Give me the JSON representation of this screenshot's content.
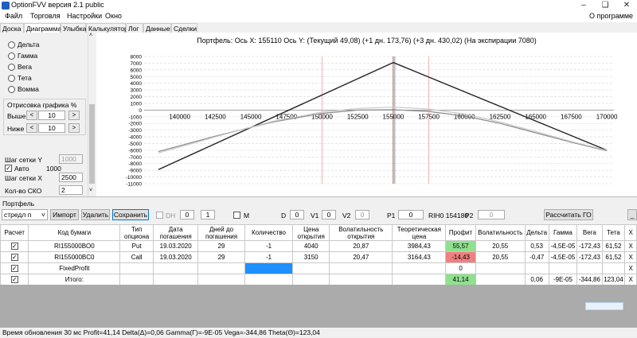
{
  "window": {
    "title": "OptionFVV версия 2.1 public"
  },
  "menu": {
    "items": [
      "Файл",
      "Торговля",
      "Настройки",
      "Окно"
    ],
    "right": "О программе"
  },
  "tabs": [
    {
      "label": "Доска",
      "active": false
    },
    {
      "label": "Диаграмма",
      "active": true
    },
    {
      "label": "Улыбка",
      "active": false
    },
    {
      "label": "Калькулятор",
      "active": false
    },
    {
      "label": "Лог",
      "active": false
    },
    {
      "label": "Данные",
      "active": false
    },
    {
      "label": "Сделки",
      "active": false
    }
  ],
  "left_panel": {
    "radios": [
      "Дельта",
      "Гамма",
      "Вега",
      "Тета",
      "Вомма"
    ],
    "plot_group": {
      "title": "Отрисовка графика %",
      "above_label": "Выше",
      "above_value": "10",
      "below_label": "Ниже",
      "below_value": "10"
    },
    "grid_y_label": "Шаг сетки Y",
    "grid_y_value": "1000",
    "auto_label": "Авто",
    "auto_checked": true,
    "auto_value": "1000",
    "grid_x_label": "Шаг сетки X",
    "grid_x_value": "2500",
    "sko_label": "Кол-во СКО",
    "sko_value": "2"
  },
  "chart_data": {
    "type": "line",
    "title": "Портфель:  Ось X: 155110 Ось Y:  (Текущий 49,08)  (+1 дн. 173,76)  (+3 дн. 430,02)  (На экспирации 7080)",
    "x_ticks": [
      140000,
      142500,
      145000,
      147500,
      150000,
      152500,
      155000,
      157500,
      160000,
      162500,
      165000,
      167500,
      170000
    ],
    "x_tick_labels": [
      "140000",
      "142500",
      "145000",
      "147500",
      "150000",
      "152500",
      "155000",
      "157500",
      "160000",
      "162500",
      "165000",
      "167500",
      "170000"
    ],
    "y_ticks": [
      8000,
      7000,
      6000,
      5000,
      4000,
      3000,
      2000,
      1000,
      0,
      -1000,
      -2000,
      -3000,
      -4000,
      -5000,
      -6000,
      -7000,
      -8000,
      -9000,
      -10000,
      -11000
    ],
    "y_tick_labels": [
      "8000",
      "7000",
      "6000",
      "5000",
      "4000",
      "3000",
      "2000",
      "1000",
      "0",
      "-1000",
      "-2000",
      "-3000",
      "-4000",
      "-5000",
      "-6000",
      "-7000",
      "-8000",
      "-9000",
      "-10000",
      "-11000"
    ],
    "xlim": [
      137500,
      170500
    ],
    "ylim": [
      -11000,
      8000
    ],
    "grid": true,
    "series": [
      {
        "role": "expiration",
        "color": "#222222",
        "x": [
          138500,
          155000,
          170000
        ],
        "y": [
          -8900,
          7100,
          -6000
        ]
      },
      {
        "role": "current",
        "color": "#8a8a8a",
        "x": [
          138500,
          142500,
          146500,
          150000,
          152500,
          155000,
          157500,
          160000,
          162500,
          165000,
          167500,
          170000
        ],
        "y": [
          -6200,
          -3900,
          -1800,
          -500,
          0,
          49,
          -200,
          -900,
          -2000,
          -3400,
          -4800,
          -6100
        ]
      },
      {
        "role": "plus_3d",
        "color": "#c8c8c8",
        "x": [
          138500,
          142500,
          146500,
          150000,
          152500,
          155000,
          157500,
          160000,
          162500,
          165000,
          167500,
          170000
        ],
        "y": [
          -6400,
          -4000,
          -1700,
          -300,
          250,
          430,
          150,
          -600,
          -1800,
          -3200,
          -4700,
          -6000
        ]
      }
    ],
    "markers": {
      "red_lines": [
        150000,
        157500
      ],
      "dark_line": 155000,
      "cursor_x": 155110
    }
  },
  "portfolio": {
    "label": "Портфель",
    "select_value": "стредл п",
    "import_label": "Импорт",
    "delete_label": "Удалить",
    "save_label": "Сохранить",
    "dh_label": "DH",
    "spin1": "0",
    "spin2": "1",
    "m_label": "M",
    "d_label": "D",
    "d_value": "0",
    "v1_label": "V1",
    "v1_value": "0",
    "v2_label": "V2",
    "v2_value": "0",
    "p1_label": "P1",
    "p1_value": "0",
    "rih_label": "RIH0 154180",
    "p2_label": "P2",
    "p2_value": "0",
    "calc_label": "Рассчитать ГО",
    "min_label": "_"
  },
  "table": {
    "headers": [
      "Расчет",
      "Код бумаги",
      "Тип опциона",
      "Дата погашения",
      "Дней до погашения",
      "Количество",
      "Цена открытия",
      "Волатильность открытия",
      "Теоретическая цена",
      "Профит",
      "Волатильность",
      "Дельта",
      "Гамма",
      "Вега",
      "Тета",
      "X"
    ],
    "rows": [
      {
        "check": true,
        "cells": [
          "RI155000BO0",
          "Put",
          "19.03.2020",
          "29",
          "-1",
          "4040",
          "20,87",
          "3984,43",
          "55,57",
          "20,55",
          "0,53",
          "-4,5E-05",
          "-172,43",
          "61,52",
          "X"
        ]
      },
      {
        "check": true,
        "cells": [
          "RI155000BC0",
          "Call",
          "19.03.2020",
          "29",
          "-1",
          "3150",
          "20,47",
          "3164,43",
          "-14,43",
          "20,55",
          "-0,47",
          "-4,5E-05",
          "-172,43",
          "61,52",
          "X"
        ]
      },
      {
        "check": true,
        "cells": [
          "FixedProfit",
          "",
          "",
          "",
          "",
          "",
          "",
          "",
          "0",
          "",
          "",
          "",
          "",
          "",
          "X"
        ]
      },
      {
        "check": true,
        "cells": [
          "Итого:",
          "",
          "",
          "",
          "",
          "",
          "",
          "",
          "41,14",
          "",
          "0,06",
          "-9E-05",
          "-344,86",
          "123,04",
          "X"
        ]
      }
    ],
    "profit_colors": {
      "positive": "#90e090",
      "negative": "#f08080"
    }
  },
  "status": "Время обновления 30 мс  Profit=41,14 Delta(Δ)=0,06 Gamma(Γ)=-9E-05 Vega=-344,86 Theta(Θ)=123,04"
}
